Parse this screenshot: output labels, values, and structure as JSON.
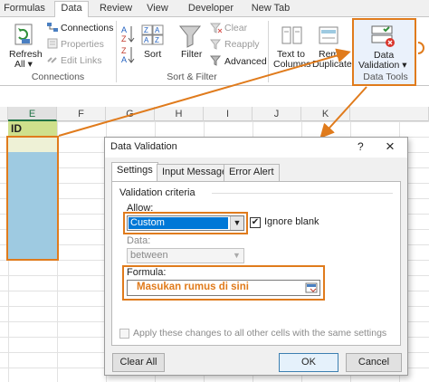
{
  "ribbon": {
    "tabs": [
      {
        "label": "Formulas"
      },
      {
        "label": "Data"
      },
      {
        "label": "Review"
      },
      {
        "label": "View"
      },
      {
        "label": "Developer"
      },
      {
        "label": "New Tab"
      }
    ],
    "connections_group": {
      "refresh_line1": "Refresh",
      "refresh_line2": "All ▾",
      "connections": "Connections",
      "properties": "Properties",
      "edit_links": "Edit Links",
      "label": "Connections"
    },
    "sort_filter_group": {
      "sort": "Sort",
      "filter": "Filter",
      "clear": "Clear",
      "reapply": "Reapply",
      "advanced": "Advanced",
      "label": "Sort & Filter"
    },
    "data_tools_group": {
      "text_to_columns_line1": "Text to",
      "text_to_columns_line2": "Columns",
      "remove_duplicates_line1": "Remo",
      "remove_duplicates_line2": "Duplicates",
      "data_validation_line1": "Data",
      "data_validation_line2": "Validation ▾",
      "label": "Data Tools"
    }
  },
  "sheet": {
    "columns": [
      "E",
      "F",
      "G",
      "H",
      "I",
      "J",
      "K"
    ],
    "header_cell": "ID"
  },
  "dialog": {
    "title": "Data Validation",
    "help": "?",
    "close": "×",
    "tabs": [
      {
        "label": "Settings"
      },
      {
        "label": "Input Message"
      },
      {
        "label": "Error Alert"
      }
    ],
    "criteria_label": "Validation criteria",
    "allow_label": "Allow:",
    "allow_value": "Custom",
    "ignore_blank_label": "Ignore blank",
    "ignore_blank_checked": true,
    "data_label": "Data:",
    "data_value": "between",
    "formula_label": "Formula:",
    "formula_hint": "Masukan rumus di sini",
    "apply_all_label": "Apply these changes to all other cells with the same settings",
    "clear_all_button": "Clear All",
    "ok_button": "OK",
    "cancel_button": "Cancel"
  },
  "colors": {
    "annotation": "#e07b1c",
    "selection_fill": "#9ecae1",
    "combo_selected": "#0078d7",
    "excel_green": "#217346"
  }
}
